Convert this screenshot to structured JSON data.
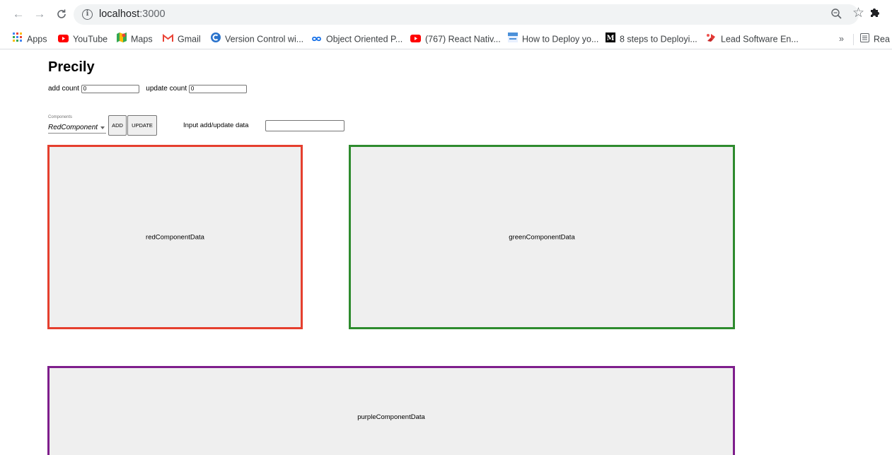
{
  "browser": {
    "url_host": "localhost",
    "url_port": ":3000",
    "bookmarks": [
      {
        "label": "Apps",
        "icon": "apps-grid-icon"
      },
      {
        "label": "YouTube",
        "icon": "youtube-icon"
      },
      {
        "label": "Maps",
        "icon": "maps-icon"
      },
      {
        "label": "Gmail",
        "icon": "gmail-icon"
      },
      {
        "label": "Version Control wi...",
        "icon": "coursera-icon"
      },
      {
        "label": "Object Oriented P...",
        "icon": "infinity-icon"
      },
      {
        "label": "(767) React Nativ...",
        "icon": "youtube-icon"
      },
      {
        "label": "How to Deploy yo...",
        "icon": "site-icon"
      },
      {
        "label": "8 steps to Deployi...",
        "icon": "medium-icon"
      },
      {
        "label": "Lead Software En...",
        "icon": "lead-icon"
      }
    ],
    "more_bookmarks": "»",
    "reading_list": "Rea",
    "colors": {
      "youtube": "#ff0000",
      "gmail": "#ea4335",
      "coursera": "#2a73cc",
      "lead": "#e53935"
    }
  },
  "app": {
    "title": "Precily",
    "add_count_label": "add count",
    "add_count_value": "0",
    "update_count_label": "update count",
    "update_count_value": "0",
    "select": {
      "label": "Components",
      "value": "RedComponent"
    },
    "add_button": "ADD",
    "update_button": "UPDATE",
    "data_input_label": "Input add/update data",
    "data_input_value": "",
    "panels": {
      "red": {
        "text": "redComponentData",
        "border": "#e53f2e"
      },
      "green": {
        "text": "greenComponentData",
        "border": "#2e8b2e"
      },
      "purple": {
        "text": "purpleComponentData",
        "border": "#7e1e8c"
      }
    }
  }
}
